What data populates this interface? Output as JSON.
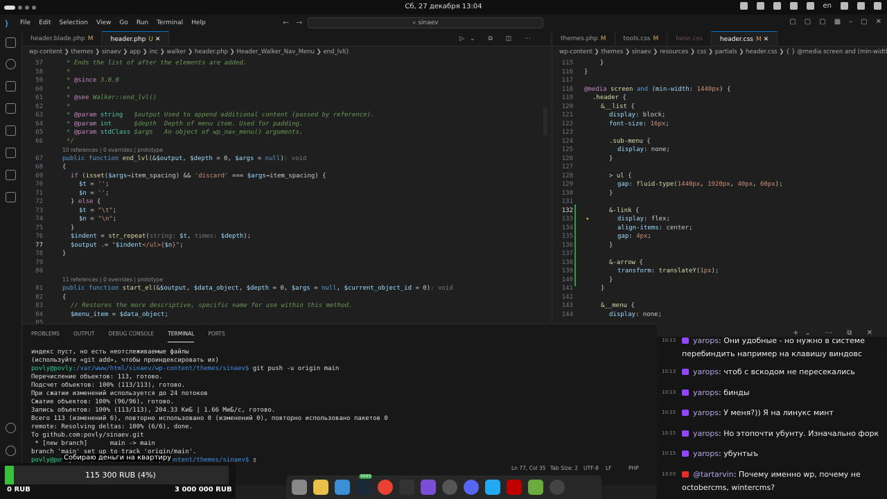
{
  "topbar": {
    "clock": "Сб, 27 декабря 13:04",
    "lang": "en"
  },
  "menu": [
    "File",
    "Edit",
    "Selection",
    "View",
    "Go",
    "Run",
    "Terminal",
    "Help"
  ],
  "command_center": {
    "text": "sinaev"
  },
  "left_editor": {
    "tabs": [
      {
        "label": "header.blade.php",
        "mod": "M",
        "active": false
      },
      {
        "label": "header.php",
        "mod": "U",
        "active": true
      }
    ],
    "breadcrumbs": "wp-content ❯ themes ❯ sinaev ❯ app ❯ inc ❯ walker ❯ header.php ❯ Header_Walker_Nav_Menu ❯ end_lvl()",
    "hint1": "10 references | 0 overrides | prototype",
    "hint2": "11 references | 0 overrides | prototype",
    "lines": [
      "57",
      "58",
      "59",
      "60",
      "61",
      "62",
      "63",
      "64",
      "65",
      "66",
      "67",
      "68",
      "69",
      "70",
      "71",
      "72",
      "73",
      "74",
      "75",
      "76",
      "77",
      "78",
      "79",
      "80",
      "81",
      "82",
      "83",
      "84",
      "85"
    ]
  },
  "right_editor": {
    "tabs": [
      {
        "label": "themes.php",
        "mod": "M"
      },
      {
        "label": "tools.css",
        "mod": "M"
      },
      {
        "label": "base.css",
        "mod": ""
      },
      {
        "label": "header.css",
        "mod": "M"
      }
    ],
    "breadcrumbs": "wp-content ❯ themes ❯ sinaev ❯ resources ❯ css ❯ partials ❯ header.css ❯ { } @media screen and (min-width: 1440px) ❯"
  },
  "panel": {
    "tabs": [
      "PROBLEMS",
      "OUTPUT",
      "DEBUG CONSOLE",
      "TERMINAL",
      "PORTS"
    ],
    "terminal": [
      "индекс пуст, но есть неотслеживаемые файлы",
      "(используйте «git add», чтобы проиндексировать их)",
      "git push -u origin main",
      "Перечисление объектов: 113, готово.",
      "Подсчет объектов: 100% (113/113), готово.",
      "При сжатии изменений используется до 24 потоков",
      "Сжатие объектов: 100% (96/96), готово.",
      "Запись объектов: 100% (113/113), 204.33 КиБ | 1.66 МиБ/с, готово.",
      "Всего 113 (изменений 6), повторно использовано 0 (изменений 0), повторно использовано пакетов 0",
      "remote: Resolving deltas: 100% (6/6), done.",
      "To github.com:povly/sinaev.git",
      " * [new branch]      main -> main",
      "branch 'main' set up to track 'origin/main'."
    ],
    "prompt_user": "povly@povly",
    "prompt_path": ":/var/www/html/sinaev/wp-content/themes/sinaev$"
  },
  "statusbar": {
    "pos": "Ln 77, Col 35",
    "tab": "Tab Size: 2",
    "enc": "UTF-8",
    "eol": "LF",
    "lang": "PHP"
  },
  "chat": [
    {
      "time": "10:13",
      "user": "yarops",
      "text": "Они удобные - но нужно в системе перебиндить например на клавишу виндовс",
      "yt": false
    },
    {
      "time": "10:13",
      "user": "yarops",
      "text": "чтоб с вскодом не пересекались",
      "yt": false
    },
    {
      "time": "10:13",
      "user": "yarops",
      "text": "бинды",
      "yt": false
    },
    {
      "time": "10:15",
      "user": "yarops",
      "text": "У меня?)) Я на линукс минт",
      "yt": false
    },
    {
      "time": "10:15",
      "user": "yarops",
      "text": "Но этопочти убунту. Изначально форк",
      "yt": false
    },
    {
      "time": "10:15",
      "user": "yarops",
      "text": "убунтыъ",
      "yt": false
    },
    {
      "time": "13:03",
      "user": "@tartarvin",
      "text": "Почему именно wp, почему не octobercms, wintercms?",
      "yt": true
    }
  ],
  "donation": {
    "title": "Собираю деньги на квартиру",
    "amount": "115 300 RUB (4%)",
    "progress": 0.04,
    "min": "0 RUB",
    "max": "3 000 000 RUB"
  },
  "dock_badge": "9999"
}
